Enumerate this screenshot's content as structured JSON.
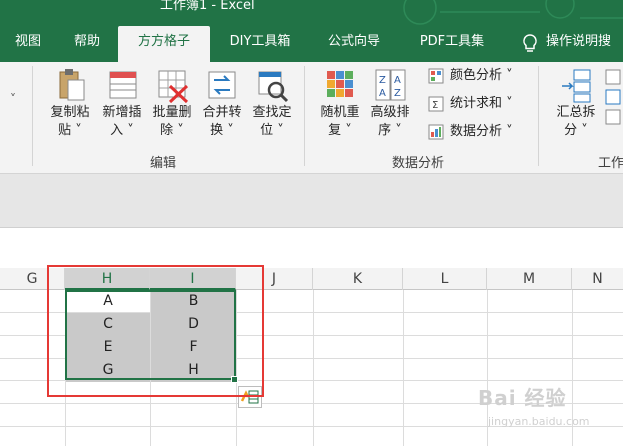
{
  "window": {
    "title": "工作簿1  -  Excel"
  },
  "tabs": [
    {
      "label": "视图",
      "active": false
    },
    {
      "label": "帮助",
      "active": false
    },
    {
      "label": "方方格子",
      "active": true
    },
    {
      "label": "DIY工具箱",
      "active": false
    },
    {
      "label": "公式向导",
      "active": false
    },
    {
      "label": "PDF工具集",
      "active": false
    },
    {
      "label": "操作说明搜",
      "active": false
    }
  ],
  "ribbon": {
    "group_edit": {
      "label": "编辑",
      "buttons": [
        {
          "line1": "复制粘",
          "line2": "贴 ˅"
        },
        {
          "line1": "新增插",
          "line2": "入 ˅"
        },
        {
          "line1": "批量删",
          "line2": "除 ˅"
        },
        {
          "line1": "合并转",
          "line2": "换 ˅"
        },
        {
          "line1": "查找定",
          "line2": "位 ˅"
        }
      ]
    },
    "group_analysis": {
      "label": "数据分析",
      "buttons": [
        {
          "line1": "随机重",
          "line2": "复 ˅"
        },
        {
          "line1": "高级排",
          "line2": "序 ˅"
        }
      ],
      "small_buttons": [
        {
          "label": "颜色分析 ˅"
        },
        {
          "label": "统计求和 ˅"
        },
        {
          "label": "数据分析 ˅"
        }
      ]
    },
    "group_work": {
      "label": "工作",
      "buttons": [
        {
          "line1": "汇总拆",
          "line2": "分 ˅"
        }
      ]
    },
    "left_chevron": "˅"
  },
  "sheet": {
    "columns": [
      "G",
      "H",
      "I",
      "J",
      "K",
      "L",
      "M",
      "N"
    ],
    "cells": [
      [
        "A",
        "B"
      ],
      [
        "C",
        "D"
      ],
      [
        "E",
        "F"
      ],
      [
        "G",
        "H"
      ]
    ]
  },
  "watermark": {
    "text": "Bai 经验",
    "sub": "jingyan.baidu.com"
  },
  "colors": {
    "accent": "#217346",
    "highlight_box": "#e53935",
    "selected_fill": "#c9c9c9"
  }
}
